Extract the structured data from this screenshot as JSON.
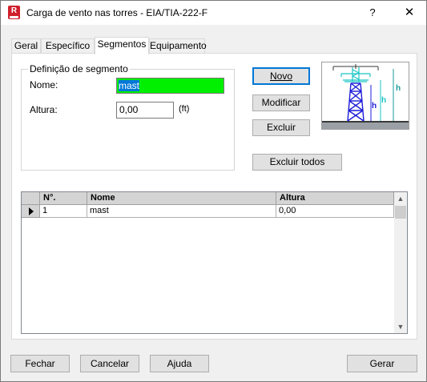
{
  "window": {
    "title": "Carga de vento nas torres - EIA/TIA-222-F",
    "icon_letter": "R",
    "help_glyph": "?",
    "close_glyph": "✕"
  },
  "tabs": [
    {
      "label": "Geral"
    },
    {
      "label": "Específico"
    },
    {
      "label": "Segmentos",
      "active": true
    },
    {
      "label": "Equipamento"
    }
  ],
  "segment": {
    "group_title": "Definição de segmento",
    "name_label": "Nome:",
    "name_value": "mast",
    "height_label": "Altura:",
    "height_value": "0,00",
    "height_unit": "(ft)"
  },
  "buttons": {
    "new": "Novo",
    "modify": "Modificar",
    "delete": "Excluir",
    "delete_all": "Excluir todos"
  },
  "diagram": {
    "label_h": "h",
    "tower_color": "#1c1cd8",
    "cyan_color": "#19c4c4",
    "teal_color": "#1a9a9a"
  },
  "table": {
    "columns": [
      "N°.",
      "Nome",
      "Altura"
    ],
    "rows": [
      {
        "num": "1",
        "name": "mast",
        "height": "0,00"
      }
    ]
  },
  "footer": {
    "close": "Fechar",
    "cancel": "Cancelar",
    "help": "Ajuda",
    "generate": "Gerar"
  }
}
